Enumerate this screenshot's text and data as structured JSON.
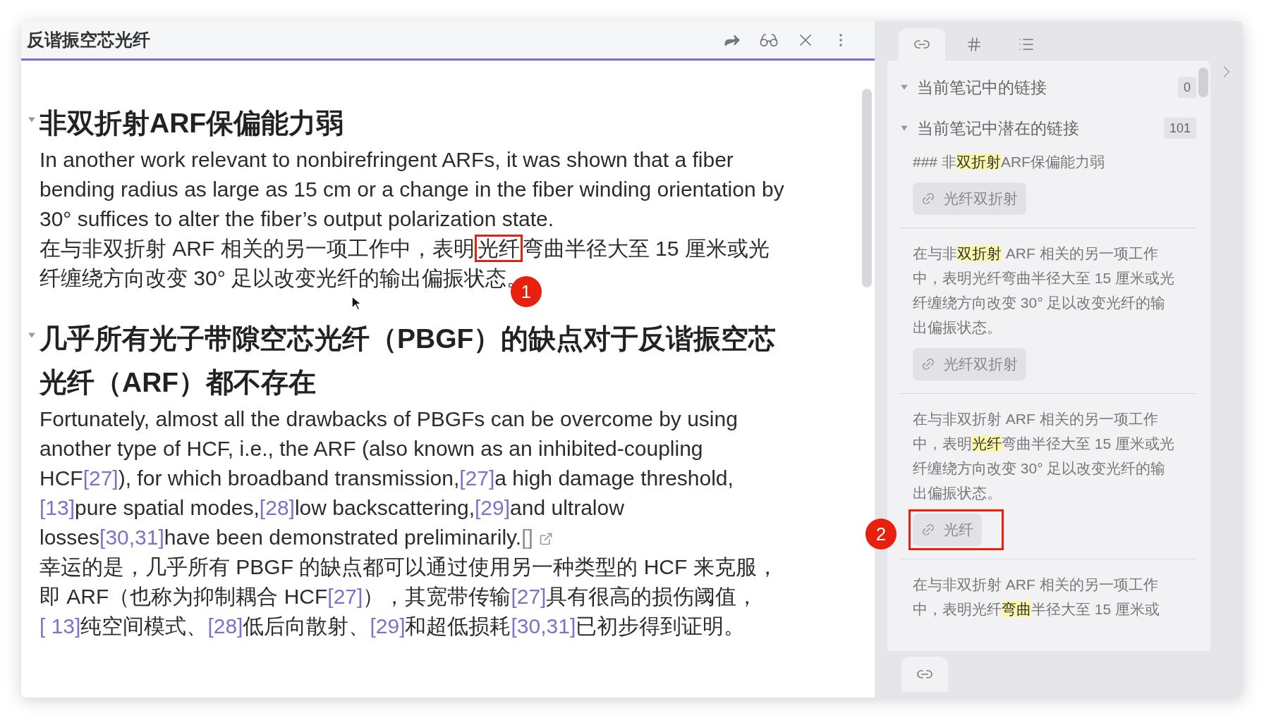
{
  "editor": {
    "title": "反谐振空芯光纤",
    "sections": [
      {
        "heading": "非双折射ARF保偏能力弱",
        "expanded": true,
        "paragraphs": [
          [
            {
              "kind": "text",
              "text": "In another work relevant to nonbirefringent ARFs, it was shown that a fiber bending radius as large as 15 cm or a change in the fiber winding orientation by 30° suffices to alter the fiber’s output polarization state."
            }
          ],
          [
            {
              "kind": "text",
              "text": "在与非双折射 ARF 相关的另一项工作中，表明"
            },
            {
              "kind": "boxed",
              "text": "光纤",
              "badge": "1"
            },
            {
              "kind": "text",
              "text": "弯曲半径大至 15 厘米或光纤缠绕方向改变 30° 足以改变光纤的输出偏振状态。"
            }
          ]
        ]
      },
      {
        "heading": "几乎所有光子带隙空芯光纤（PBGF）的缺点对于反谐振空芯光纤（ARF）都不存在",
        "expanded": true,
        "paragraphs": [
          [
            {
              "kind": "text",
              "text": "Fortunately, almost all the drawbacks of PBGFs can be overcome by using another type of HCF, i.e., the ARF (also known as an inhibited-coupling HCF"
            },
            {
              "kind": "citation",
              "text": "[27]"
            },
            {
              "kind": "text",
              "text": "), for which broadband transmission,"
            },
            {
              "kind": "citation",
              "text": "[27]"
            },
            {
              "kind": "text",
              "text": "a high damage threshold,"
            },
            {
              "kind": "citation",
              "text": "[13]"
            },
            {
              "kind": "text",
              "text": "pure spatial modes,"
            },
            {
              "kind": "citation",
              "text": "[28]"
            },
            {
              "kind": "text",
              "text": "low backscattering,"
            },
            {
              "kind": "citation",
              "text": "[29]"
            },
            {
              "kind": "text",
              "text": "and ultralow losses"
            },
            {
              "kind": "citation",
              "text": "[30,31]"
            },
            {
              "kind": "text",
              "text": "have been demonstrated preliminarily."
            },
            {
              "kind": "external",
              "text": "[]"
            }
          ],
          [
            {
              "kind": "text",
              "text": "幸运的是，几乎所有 PBGF 的缺点都可以通过使用另一种类型的 HCF 来克服，即 ARF（也称为抑制耦合 HCF"
            },
            {
              "kind": "citation",
              "text": "[27]"
            },
            {
              "kind": "text",
              "text": "），其宽带传输"
            },
            {
              "kind": "citation",
              "text": "[27]"
            },
            {
              "kind": "text",
              "text": "具有很高的损伤阈值，"
            },
            {
              "kind": "citation",
              "text": "[ 13]"
            },
            {
              "kind": "text",
              "text": "纯空间模式、"
            },
            {
              "kind": "citation",
              "text": "[28]"
            },
            {
              "kind": "text",
              "text": "低后向散射、"
            },
            {
              "kind": "citation",
              "text": "[29]"
            },
            {
              "kind": "text",
              "text": "和超低损耗"
            },
            {
              "kind": "citation",
              "text": "[30,31]"
            },
            {
              "kind": "text",
              "text": "已初步得到证明。"
            }
          ]
        ]
      }
    ]
  },
  "sidebar": {
    "tabs": [
      {
        "kind": "links",
        "selected": true
      },
      {
        "kind": "tags",
        "selected": false
      },
      {
        "kind": "outline",
        "selected": false
      }
    ],
    "groups": [
      {
        "title": "当前笔记中的链接",
        "count": "0",
        "expanded": true
      },
      {
        "title": "当前笔记中潜在的链接",
        "count": "101",
        "expanded": true,
        "matches": [
          {
            "snippet": [
              {
                "kind": "text",
                "text": "### 非"
              },
              {
                "kind": "highlight",
                "text": "双折射"
              },
              {
                "kind": "text",
                "text": "ARF保偏能力弱"
              }
            ],
            "chip": {
              "label": "光纤双折射",
              "boxed": false
            }
          },
          {
            "snippet": [
              {
                "kind": "text",
                "text": "在与非"
              },
              {
                "kind": "highlight",
                "text": "双折射"
              },
              {
                "kind": "text",
                "text": " ARF 相关的另一项工作中，表明光纤弯曲半径大至 15 厘米或光纤缠绕方向改变 30° 足以改变光纤的输出偏振状态。"
              }
            ],
            "chip": {
              "label": "光纤双折射",
              "boxed": false
            }
          },
          {
            "snippet": [
              {
                "kind": "text",
                "text": "在与非双折射 ARF 相关的另一项工作中，表明"
              },
              {
                "kind": "highlight",
                "text": "光纤"
              },
              {
                "kind": "text",
                "text": "弯曲半径大至 15 厘米或光纤缠绕方向改变 30° 足以改变光纤的输出偏振状态。"
              }
            ],
            "chip": {
              "label": "光纤",
              "boxed": true,
              "badge": "2"
            }
          },
          {
            "snippet": [
              {
                "kind": "text",
                "text": "在与非双折射 ARF 相关的另一项工作中，表明光纤"
              },
              {
                "kind": "highlight",
                "text": "弯曲"
              },
              {
                "kind": "text",
                "text": "半径大至 15 厘米或"
              }
            ]
          }
        ]
      }
    ]
  }
}
